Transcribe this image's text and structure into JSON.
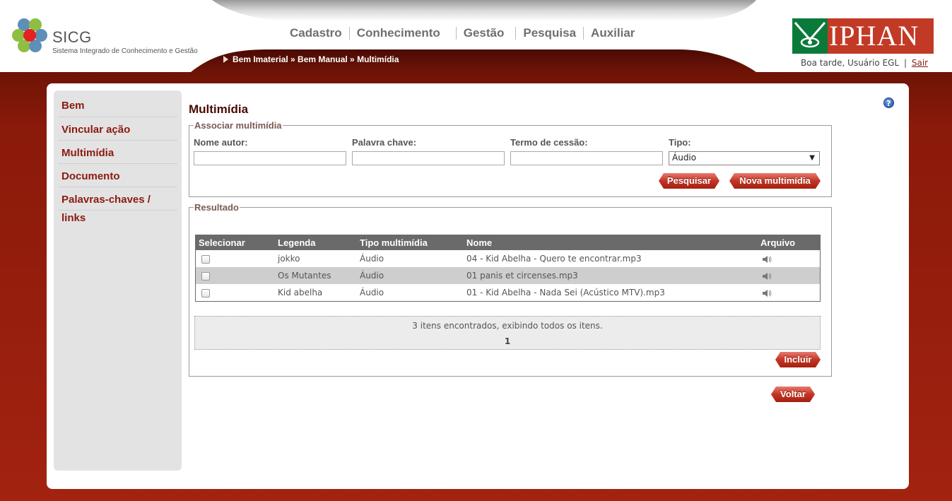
{
  "app": {
    "logo_title": "SICG",
    "logo_subtitle": "Sistema Integrado de Conhecimento e Gestão",
    "partner_logo": "IPHAN",
    "greeting": "Boa tarde, Usuário EGL",
    "greeting_sep": "|",
    "logout": "Sair"
  },
  "topnav": [
    "Cadastro",
    "Conhecimento",
    "Gestão",
    "Pesquisa",
    "Auxiliar"
  ],
  "breadcrumb": "Bem Imaterial » Bem Manual » Multimídia",
  "sidebar": [
    "Bem",
    "Vincular ação",
    "Multimídia",
    "Documento",
    "Palavras-chaves / links"
  ],
  "page": {
    "title": "Multimídia",
    "help_icon": "?"
  },
  "search": {
    "legend": "Associar multimídia",
    "author_label": "Nome autor:",
    "author_value": "",
    "keyword_label": "Palavra chave:",
    "keyword_value": "",
    "term_label": "Termo de cessão:",
    "term_value": "",
    "type_label": "Tipo:",
    "type_value": "Áudio",
    "search_button": "Pesquisar",
    "new_button": "Nova multimídia"
  },
  "results": {
    "legend": "Resultado",
    "columns": [
      "Selecionar",
      "Legenda",
      "Tipo multimídia",
      "Nome",
      "Arquivo"
    ],
    "rows": [
      {
        "legenda": "jokko",
        "tipo": "Áudio",
        "nome": "04 - Kid Abelha - Quero te encontrar.mp3",
        "arquivo_icon": "speaker-icon"
      },
      {
        "legenda": "Os Mutantes",
        "tipo": "Áudio",
        "nome": "01 panis et circenses.mp3",
        "arquivo_icon": "speaker-icon"
      },
      {
        "legenda": "Kid abelha",
        "tipo": "Áudio",
        "nome": "01 - Kid Abelha - Nada Sei (Acústico MTV).mp3",
        "arquivo_icon": "speaker-icon"
      }
    ],
    "pager_text": "3 itens encontrados, exibindo todos os itens.",
    "pager_page": "1",
    "include_button": "Incluir"
  },
  "back_button": "Voltar",
  "colors": {
    "brand_dark_red": "#5a0d04",
    "accent_red": "#c23526",
    "link_red": "#8b1a10",
    "iphan_green": "#0a7a3a"
  }
}
